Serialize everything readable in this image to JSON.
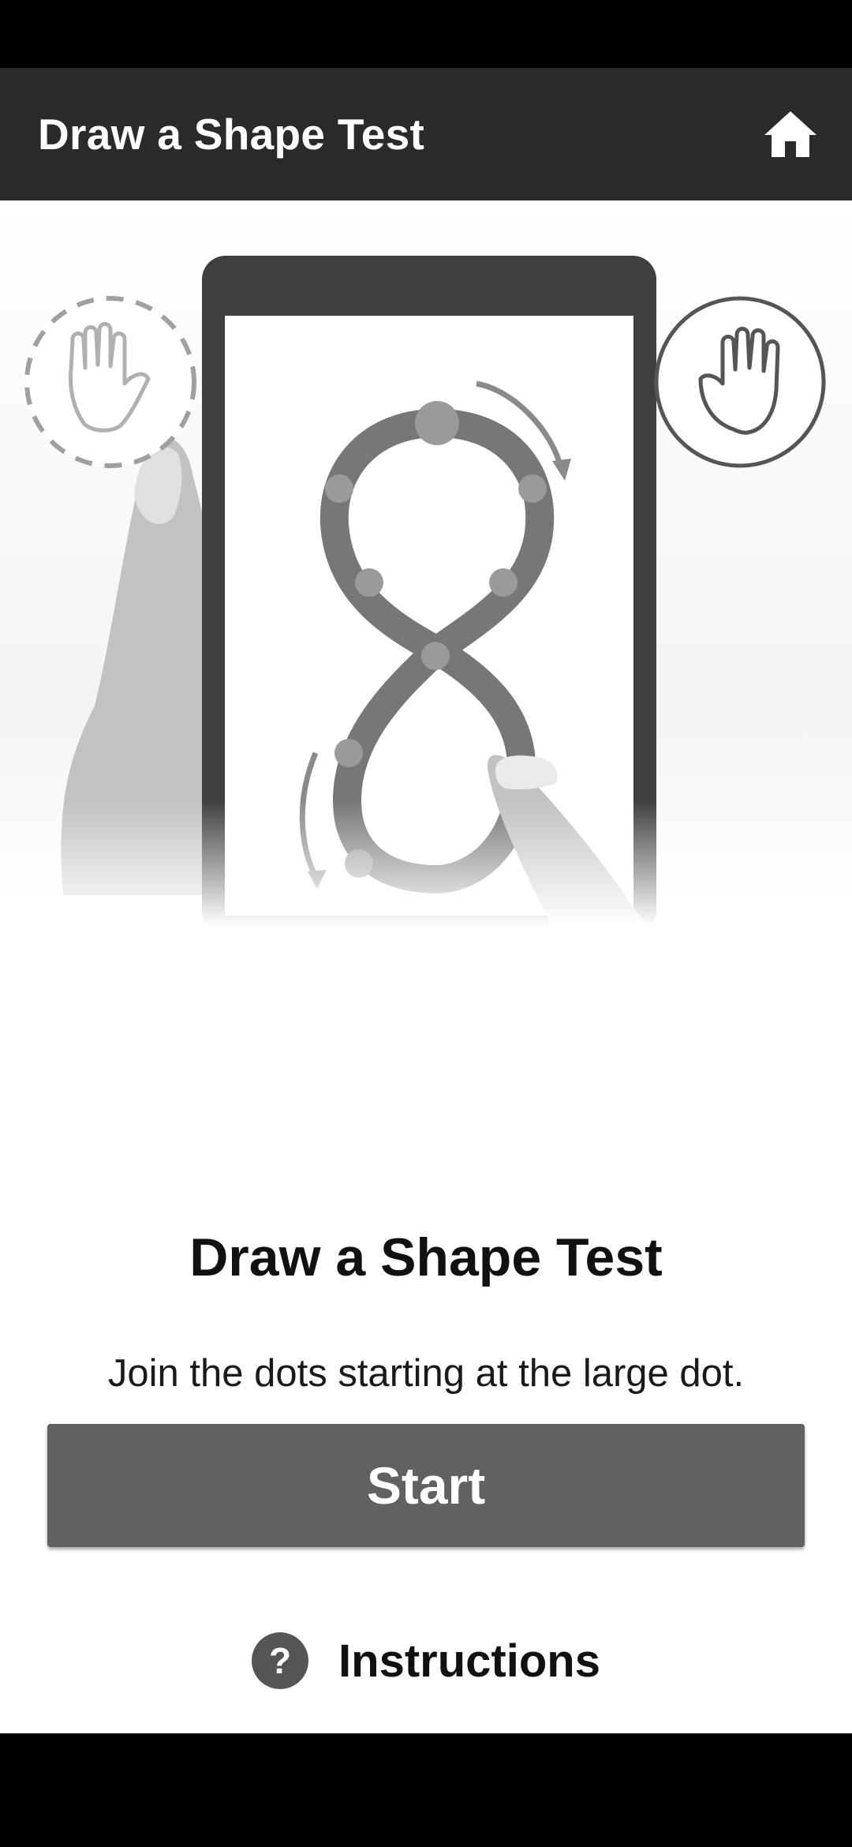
{
  "app_bar": {
    "title": "Draw a Shape Test",
    "home_icon": "home-icon"
  },
  "hero": {
    "illustration": "phone-figure-eight-illustration",
    "left_hand_icon": "hand-icon-dashed",
    "right_hand_icon": "hand-icon-solid"
  },
  "main": {
    "title": "Draw a Shape Test",
    "subtitle": "Join the dots starting at the large dot.",
    "start_label": "Start",
    "instructions_label": "Instructions",
    "help_icon_glyph": "?"
  },
  "colors": {
    "app_bar": "#2a2a2a",
    "button": "#616161",
    "background": "#ffffff"
  }
}
